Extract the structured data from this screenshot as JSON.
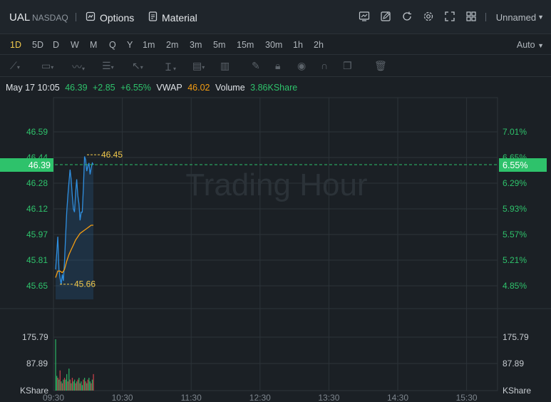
{
  "header": {
    "symbol": "UAL",
    "exchange": "NASDAQ",
    "options_label": "Options",
    "material_label": "Material",
    "layout_name": "Unnamed"
  },
  "periods": [
    "1D",
    "5D",
    "D",
    "W",
    "M",
    "Q",
    "Y",
    "1m",
    "2m",
    "3m",
    "5m",
    "15m",
    "30m",
    "1h",
    "2h"
  ],
  "active_period": "1D",
  "scale_mode": "Auto",
  "quote": {
    "datetime": "May 17 10:05",
    "price": "46.39",
    "change": "+2.85",
    "change_pct": "+6.55%",
    "vwap_label": "VWAP",
    "vwap": "46.02",
    "volume_label": "Volume",
    "volume": "3.86KShare"
  },
  "watermark": "Trading Hour",
  "colors": {
    "up": "#2ec26b",
    "down": "#e0444f",
    "price_line": "#2f8fe0",
    "vwap_line": "#f39c12",
    "highlight": "#2ec26b",
    "marker": "#f2c94c"
  },
  "chart_data": {
    "type": "line",
    "x_ticks": [
      "09:30",
      "10:30",
      "11:30",
      "12:30",
      "13:30",
      "14:30",
      "15:30"
    ],
    "price_axis_left": [
      "46.59",
      "46.44",
      "46.28",
      "46.12",
      "45.97",
      "45.81",
      "45.65"
    ],
    "percent_axis_right": [
      "7.01%",
      "6.65%",
      "6.29%",
      "5.93%",
      "5.57%",
      "5.21%",
      "4.85%"
    ],
    "current_price_label": "46.39",
    "current_percent_label": "6.55%",
    "high_marker": "46.45",
    "low_marker": "45.66",
    "ylim": [
      45.6,
      46.7
    ],
    "volume_axis": [
      "175.79",
      "87.89"
    ],
    "volume_unit": "KShare",
    "series": [
      {
        "name": "Price",
        "x": [
          0,
          1,
          2,
          3,
          4,
          5,
          6,
          7,
          8,
          9,
          10,
          11,
          12,
          13,
          14,
          15,
          16,
          17,
          18,
          19,
          20,
          21,
          22,
          23,
          24,
          25,
          26,
          27,
          28,
          29,
          30,
          31,
          32,
          33,
          34
        ],
        "values": [
          45.75,
          45.85,
          45.95,
          45.75,
          45.7,
          45.66,
          45.72,
          45.68,
          45.8,
          45.95,
          46.1,
          46.2,
          46.28,
          46.36,
          46.3,
          46.2,
          46.12,
          46.1,
          46.22,
          46.3,
          46.2,
          46.15,
          46.05,
          46.1,
          46.1,
          46.25,
          46.44,
          46.42,
          46.35,
          46.38,
          46.4,
          46.33,
          46.37,
          46.4,
          46.39
        ]
      },
      {
        "name": "VWAP",
        "x": [
          0,
          2,
          4,
          6,
          8,
          10,
          12,
          14,
          16,
          18,
          20,
          22,
          24,
          26,
          28,
          30,
          32,
          34
        ],
        "values": [
          45.7,
          45.74,
          45.74,
          45.73,
          45.75,
          45.8,
          45.84,
          45.87,
          45.9,
          45.93,
          45.95,
          45.97,
          45.98,
          45.99,
          46.0,
          46.01,
          46.02,
          46.02
        ]
      }
    ],
    "volume_series": {
      "x": [
        0,
        1,
        2,
        3,
        4,
        5,
        6,
        7,
        8,
        9,
        10,
        11,
        12,
        13,
        14,
        15,
        16,
        17,
        18,
        19,
        20,
        21,
        22,
        23,
        24,
        25,
        26,
        27,
        28,
        29,
        30,
        31,
        32,
        33,
        34
      ],
      "values": [
        140,
        40,
        35,
        30,
        55,
        25,
        20,
        30,
        35,
        30,
        45,
        25,
        60,
        30,
        20,
        35,
        25,
        30,
        20,
        25,
        30,
        35,
        20,
        25,
        15,
        30,
        35,
        25,
        20,
        30,
        35,
        25,
        20,
        30,
        45
      ],
      "up": [
        true,
        true,
        false,
        true,
        false,
        true,
        false,
        true,
        false,
        true,
        true,
        false,
        true,
        false,
        true,
        false,
        true,
        true,
        false,
        true,
        false,
        true,
        false,
        true,
        true,
        false,
        true,
        false,
        true,
        false,
        true,
        true,
        false,
        true,
        false
      ]
    }
  }
}
